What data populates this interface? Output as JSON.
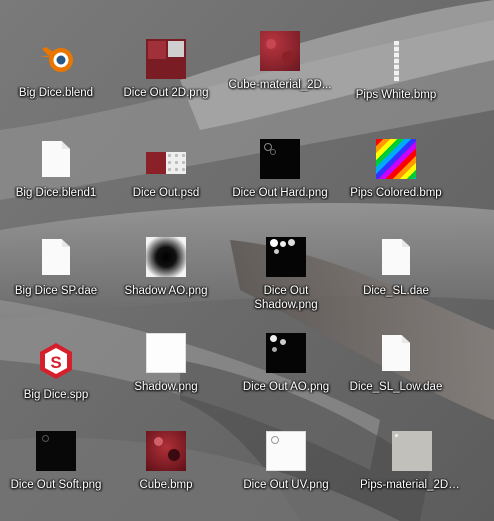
{
  "icons": [
    {
      "label": "Big Dice.blend",
      "icon": "blender-icon"
    },
    {
      "label": "Dice Out 2D.png",
      "icon": "image-thumbnail-icon"
    },
    {
      "label": "Cube-material_2D...",
      "icon": "image-thumbnail-icon"
    },
    {
      "label": "Pips White.bmp",
      "icon": "image-thumbnail-icon"
    },
    {
      "label": "Big Dice.blend1",
      "icon": "document-icon"
    },
    {
      "label": "Dice Out.psd",
      "icon": "image-thumbnail-icon"
    },
    {
      "label": "Dice Out Hard.png",
      "icon": "image-thumbnail-icon"
    },
    {
      "label": "Pips Colored.bmp",
      "icon": "image-thumbnail-icon"
    },
    {
      "label": "Big Dice SP.dae",
      "icon": "document-icon"
    },
    {
      "label": "Shadow AO.png",
      "icon": "image-thumbnail-icon"
    },
    {
      "label": "Dice Out Shadow.png",
      "icon": "image-thumbnail-icon"
    },
    {
      "label": "Dice_SL.dae",
      "icon": "document-icon"
    },
    {
      "label": "Big Dice.spp",
      "icon": "substance-painter-icon"
    },
    {
      "label": "Shadow.png",
      "icon": "image-thumbnail-icon"
    },
    {
      "label": "Dice Out AO.png",
      "icon": "image-thumbnail-icon"
    },
    {
      "label": "Dice_SL_Low.dae",
      "icon": "document-icon"
    },
    {
      "label": "Dice Out Soft.png",
      "icon": "image-thumbnail-icon"
    },
    {
      "label": "Cube.bmp",
      "icon": "image-thumbnail-icon"
    },
    {
      "label": "Dice Out UV.png",
      "icon": "image-thumbnail-icon"
    },
    {
      "label": "Pips-material_2D_...",
      "icon": "image-thumbnail-icon"
    }
  ],
  "colors": {
    "label_text": "#ffffff",
    "substance_red": "#d61f2c",
    "blender_orange": "#ea7600",
    "blender_blue": "#265787"
  }
}
